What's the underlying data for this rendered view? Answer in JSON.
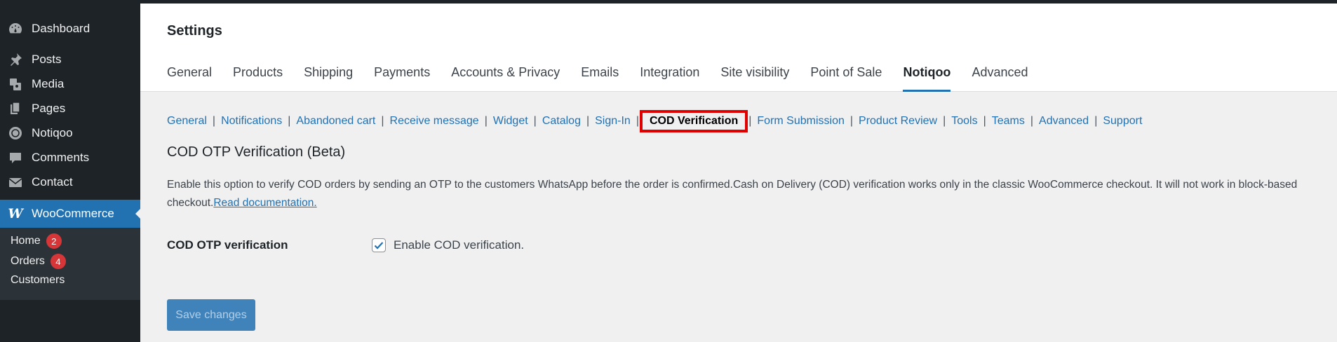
{
  "sidebar": {
    "items": [
      {
        "label": "Dashboard",
        "icon": "dashboard-icon"
      },
      {
        "label": "Posts",
        "icon": "pin-icon"
      },
      {
        "label": "Media",
        "icon": "media-icon"
      },
      {
        "label": "Pages",
        "icon": "pages-icon"
      },
      {
        "label": "Notiqoo",
        "icon": "notiqoo-icon"
      },
      {
        "label": "Comments",
        "icon": "comment-icon"
      },
      {
        "label": "Contact",
        "icon": "mail-icon"
      }
    ],
    "woocommerce": {
      "label": "WooCommerce",
      "icon": "woocommerce-icon"
    },
    "submenu": [
      {
        "label": "Home",
        "badge": "2"
      },
      {
        "label": "Orders",
        "badge": "4"
      },
      {
        "label": "Customers"
      }
    ]
  },
  "header": {
    "title": "Settings",
    "tabs": [
      "General",
      "Products",
      "Shipping",
      "Payments",
      "Accounts & Privacy",
      "Emails",
      "Integration",
      "Site visibility",
      "Point of Sale",
      "Notiqoo",
      "Advanced"
    ],
    "active_tab": "Notiqoo"
  },
  "subnav": {
    "links": [
      "General",
      "Notifications",
      "Abandoned cart",
      "Receive message",
      "Widget",
      "Catalog",
      "Sign-In",
      "COD Verification",
      "Form Submission",
      "Product Review",
      "Tools",
      "Teams",
      "Advanced",
      "Support"
    ],
    "current": "COD Verification"
  },
  "section": {
    "title": "COD OTP Verification (Beta)",
    "description": "Enable this option to verify COD orders by sending an OTP to the customers WhatsApp before the order is confirmed.Cash on Delivery (COD) verification works only in the classic WooCommerce checkout. It will not work in block-based checkout.",
    "doc_link": "Read documentation."
  },
  "field": {
    "label": "COD OTP verification",
    "checkbox_label": "Enable COD verification.",
    "checked": true
  },
  "save_button": "Save changes",
  "colors": {
    "sidebar_bg": "#1d2327",
    "accent": "#2271b1",
    "badge": "#d63638",
    "highlight_box": "#e00000"
  }
}
